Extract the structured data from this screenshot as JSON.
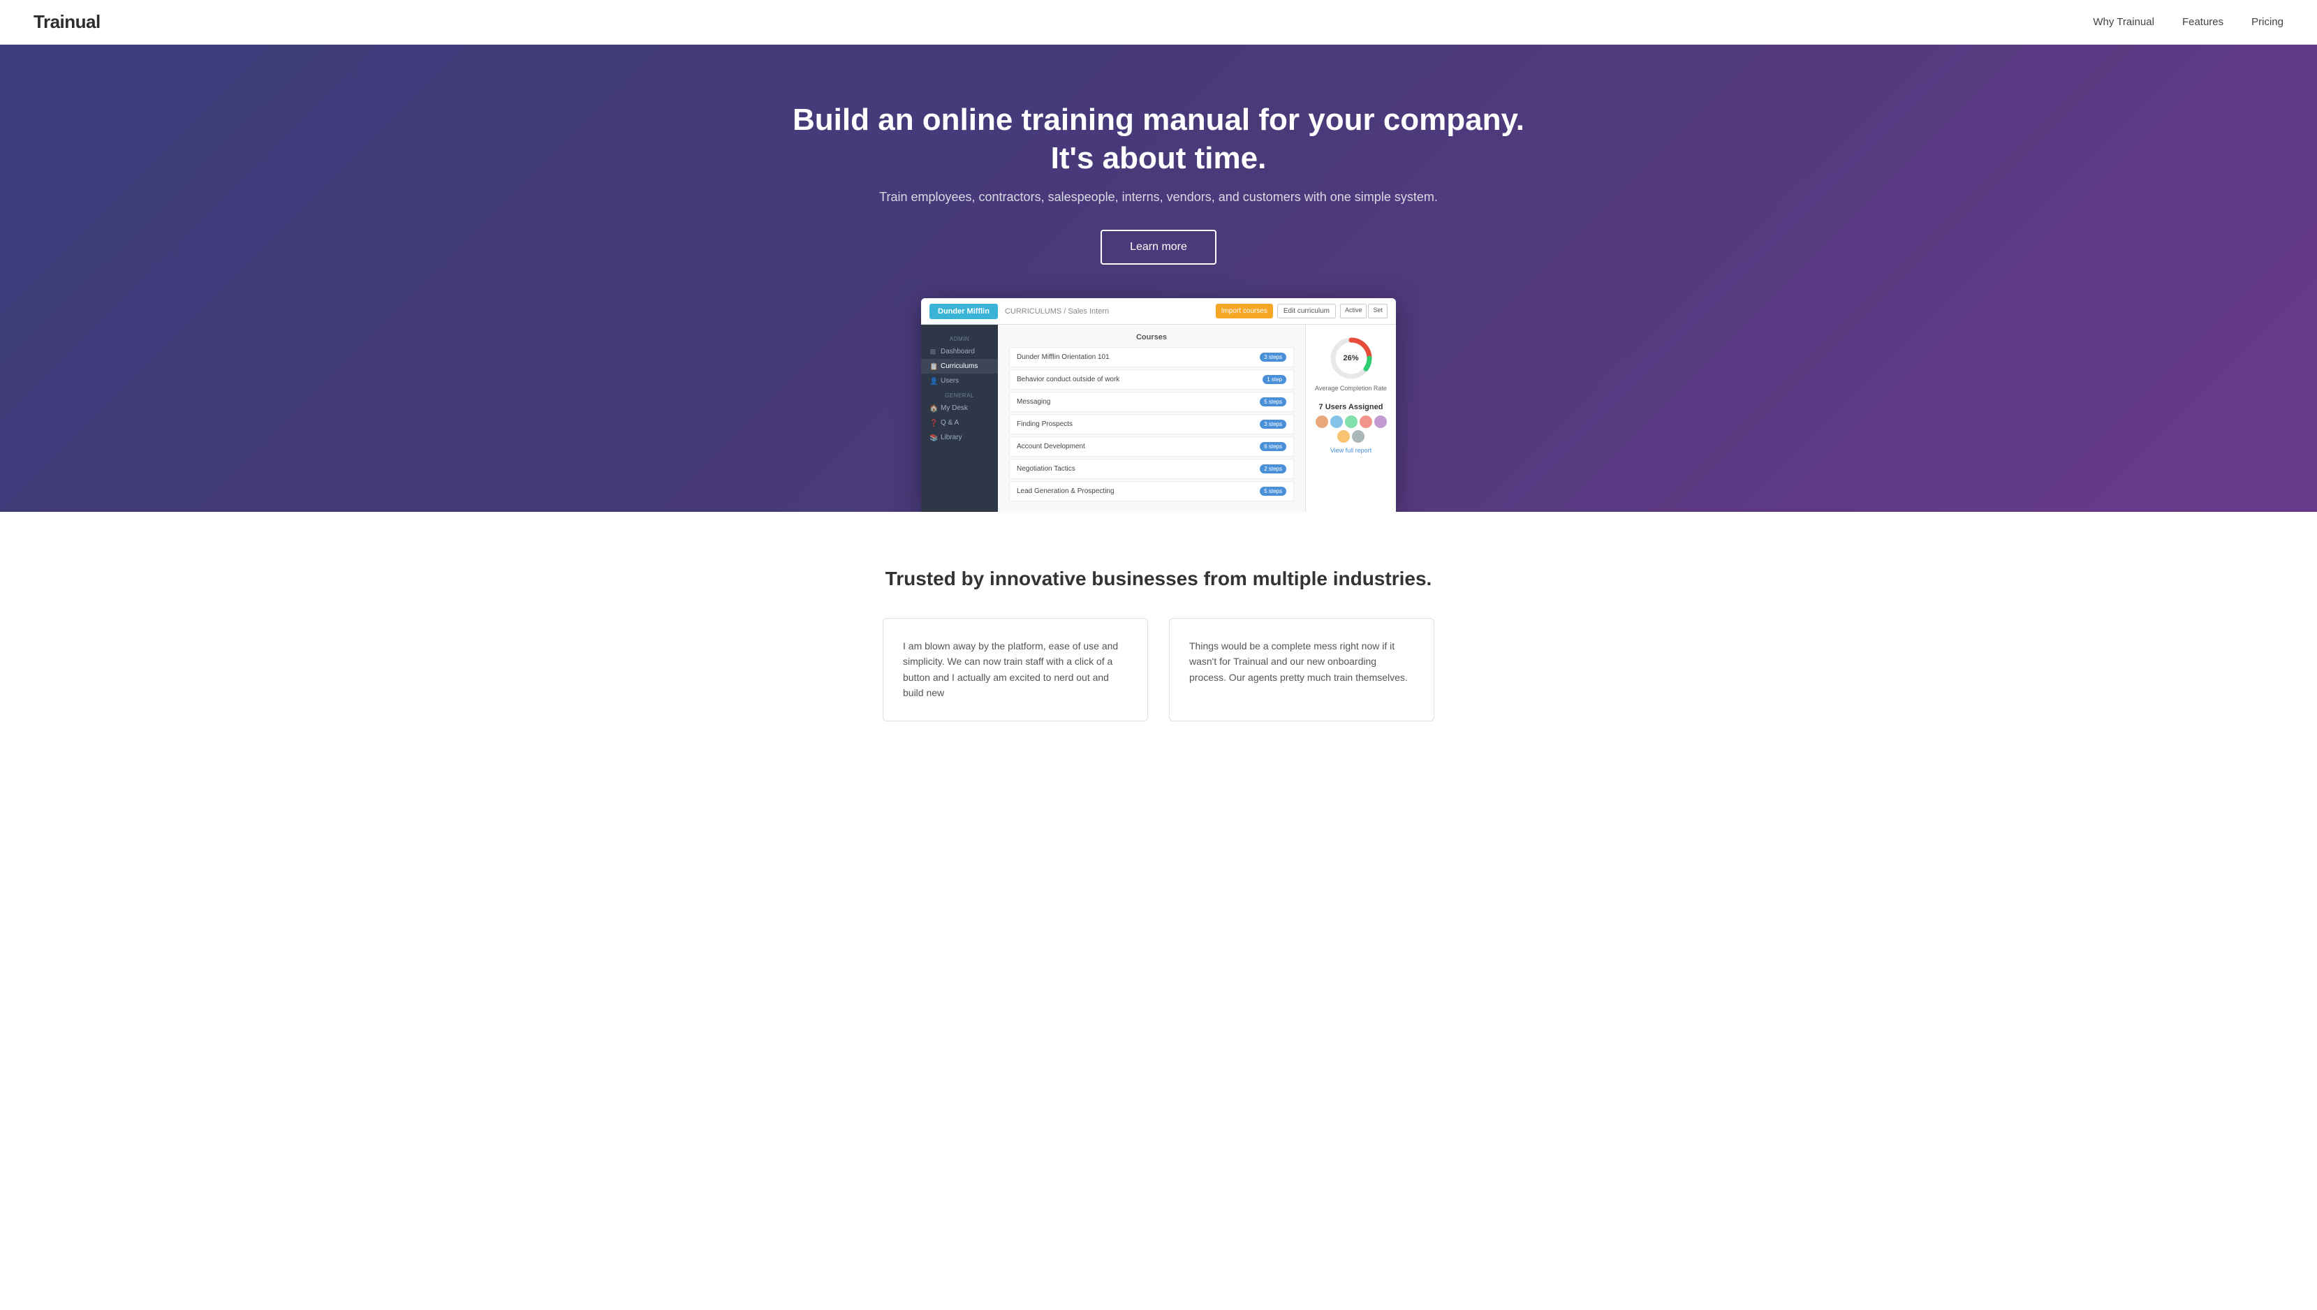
{
  "navbar": {
    "logo": "Trainual",
    "links": [
      {
        "label": "Why Trainual",
        "name": "why-trainual-link"
      },
      {
        "label": "Features",
        "name": "features-link"
      },
      {
        "label": "Pricing",
        "name": "pricing-link"
      }
    ]
  },
  "hero": {
    "title_line1": "Build an online training manual for your company.",
    "title_line2": "It's about time.",
    "subtitle": "Train employees, contractors, salespeople, interns, vendors, and customers with one simple system.",
    "cta_label": "Learn more"
  },
  "app_screenshot": {
    "org_tab": "Dunder Mifflin",
    "breadcrumb": "CURRICULUMS / Sales Intern",
    "btn_import": "Import courses",
    "btn_edit": "Edit curriculum",
    "btn_active": "Active",
    "btn_set": "Set",
    "sidebar": {
      "admin_label": "ADMIN",
      "items_admin": [
        {
          "label": "Dashboard",
          "icon": "grid-icon",
          "active": false
        },
        {
          "label": "Curriculums",
          "icon": "book-icon",
          "active": true
        },
        {
          "label": "Users",
          "icon": "users-icon",
          "active": false
        }
      ],
      "general_label": "GENERAL",
      "items_general": [
        {
          "label": "My Desk",
          "icon": "home-icon",
          "active": false
        },
        {
          "label": "Q & A",
          "icon": "question-icon",
          "active": false
        },
        {
          "label": "Library",
          "icon": "library-icon",
          "active": false
        }
      ]
    },
    "courses_header": "Courses",
    "courses": [
      {
        "name": "Dunder Mifflin Orientation 101",
        "badge": "3 steps",
        "badge_color": "blue"
      },
      {
        "name": "Behavior conduct outside of work",
        "badge": "1 step",
        "badge_color": "blue"
      },
      {
        "name": "Messaging",
        "badge": "5 steps",
        "badge_color": "blue"
      },
      {
        "name": "Finding Prospects",
        "badge": "3 steps",
        "badge_color": "blue"
      },
      {
        "name": "Account Development",
        "badge": "6 steps",
        "badge_color": "blue"
      },
      {
        "name": "Negotiation Tactics",
        "badge": "2 steps",
        "badge_color": "blue"
      },
      {
        "name": "Lead Generation & Prospecting",
        "badge": "5 steps",
        "badge_color": "blue"
      }
    ],
    "stats": {
      "percent": "26%",
      "percent_value": 26,
      "label": "Average Completion Rate",
      "users_count": "7 Users Assigned",
      "avatars": [
        {
          "color": "#e8a87c"
        },
        {
          "color": "#85c1e9"
        },
        {
          "color": "#82e0aa"
        },
        {
          "color": "#f1948a"
        },
        {
          "color": "#c39bd3"
        },
        {
          "color": "#f8c471"
        },
        {
          "color": "#aab7b8"
        }
      ],
      "view_link": "View full report"
    }
  },
  "trusted": {
    "title": "Trusted by innovative businesses from multiple industries.",
    "testimonials": [
      {
        "text": "I am blown away by the platform, ease of use and simplicity. We can now train staff with a click of a button and I actually am excited to nerd out and build new"
      },
      {
        "text": "Things would be a complete mess right now if it wasn't for Trainual and our new onboarding process. Our agents pretty much train themselves."
      }
    ]
  }
}
